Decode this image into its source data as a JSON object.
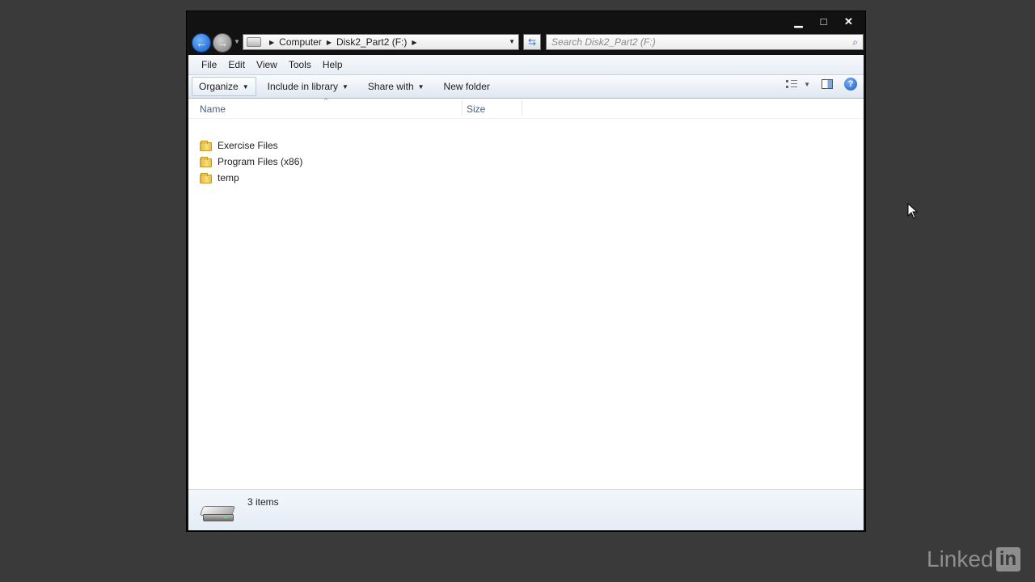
{
  "window": {
    "caption_buttons": {
      "minimize": "▁",
      "maximize": "□",
      "close": "✕"
    }
  },
  "address_bar": {
    "crumbs": [
      "Computer",
      "Disk2_Part2 (F:)"
    ],
    "search_placeholder": "Search Disk2_Part2 (F:)"
  },
  "menu": {
    "items": [
      "File",
      "Edit",
      "View",
      "Tools",
      "Help"
    ]
  },
  "commands": {
    "organize": "Organize",
    "include_in_library": "Include in library",
    "share_with": "Share with",
    "new_folder": "New folder"
  },
  "columns": {
    "name": "Name",
    "size": "Size"
  },
  "files": [
    {
      "name": "Exercise Files",
      "icon": "folder-icon"
    },
    {
      "name": "Program Files (x86)",
      "icon": "folder-icon"
    },
    {
      "name": "temp",
      "icon": "folder-icon"
    }
  ],
  "status": {
    "count": "3 items"
  },
  "watermark": {
    "text": "Linked",
    "badge": "in"
  },
  "colors": {
    "desktop": "#3a3a3a",
    "frame": "#121212",
    "accent": "#1559c4"
  }
}
